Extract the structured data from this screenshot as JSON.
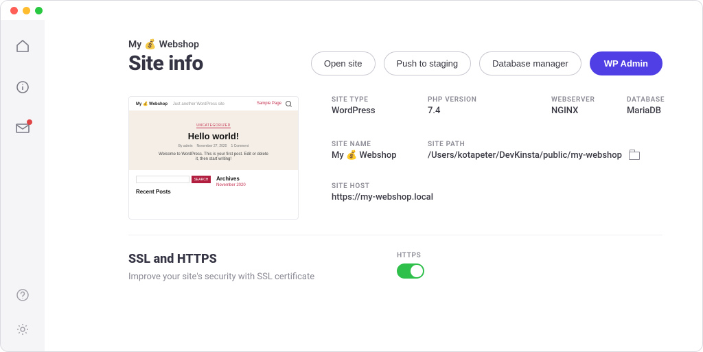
{
  "header": {
    "sitename_prefix": "My",
    "sitename_emoji": "💰",
    "sitename_suffix": "Webshop",
    "page_title": "Site info"
  },
  "actions": {
    "open_site": "Open site",
    "push_staging": "Push to staging",
    "db_manager": "Database manager",
    "wp_admin": "WP Admin"
  },
  "preview": {
    "brand": "My 💰 Webshop",
    "tagline": "Just another WordPress site",
    "sample_link": "Sample Page",
    "category": "UNCATEGORIZED",
    "post_title": "Hello world!",
    "meta_author": "By admin",
    "meta_date": "November 27, 2020",
    "meta_comments": "1 Comment",
    "body_text": "Welcome to WordPress. This is your first post. Edit or delete it, then start writing!",
    "search_btn": "SEARCH",
    "archives": "Archives",
    "archive_link": "November 2020",
    "recent": "Recent Posts"
  },
  "info": {
    "labels": {
      "site_type": "SITE TYPE",
      "php_version": "PHP VERSION",
      "webserver": "WEBSERVER",
      "database": "DATABASE",
      "site_name": "SITE NAME",
      "site_path": "SITE PATH",
      "site_host": "SITE HOST"
    },
    "values": {
      "site_type": "WordPress",
      "php_version": "7.4",
      "webserver": "NGINX",
      "database": "MariaDB",
      "site_name": "My 💰 Webshop",
      "site_path": "/Users/kotapeter/DevKinsta/public/my-webshop",
      "site_host": "https://my-webshop.local"
    }
  },
  "ssl": {
    "title": "SSL and HTTPS",
    "subtitle": "Improve your site's security with SSL certificate",
    "toggle_label": "HTTPS",
    "enabled": true
  }
}
